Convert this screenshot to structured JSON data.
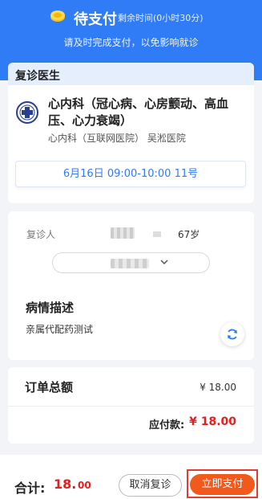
{
  "header": {
    "title": "待支付",
    "countdown": "剩余时间(0小时30分)",
    "tip": "请及时完成支付，以免影响就诊",
    "icon": "coin-icon"
  },
  "doctor_card": {
    "heading": "复诊医生",
    "department_title": "心内科（冠心病、心房颤动、高血压、心力衰竭）",
    "department_sub": "心内科（互联网医院） 吴淞医院",
    "appointment_time": "6月16日 09:00-10:00 11号"
  },
  "patient_card": {
    "patient_label": "复诊人",
    "age": "67岁",
    "view_more_icon": "chevron-down-icon",
    "description_title": "病情描述",
    "description_text": "亲属代配药测试"
  },
  "order_card": {
    "total_label": "订单总额",
    "total_value": "¥ 18.00",
    "payable_label": "应付款:",
    "payable_value": "¥ 18.00"
  },
  "bottom_bar": {
    "sum_label": "合计:",
    "sum_main": "18.",
    "sum_decimal": "00",
    "cancel_label": "取消复诊",
    "pay_label": "立即支付"
  },
  "colors": {
    "primary": "#2f7cf6",
    "price": "#e02020",
    "pay_button": "#f25a1d"
  }
}
